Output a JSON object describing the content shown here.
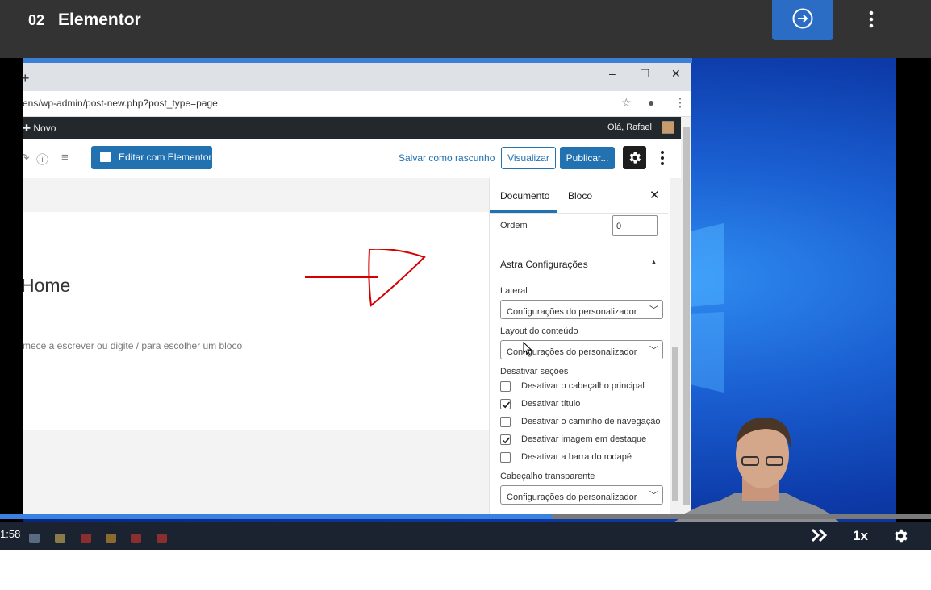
{
  "lesson": {
    "number": "02",
    "title": "Elementor"
  },
  "browser": {
    "new_tab": "+",
    "minimize": "–",
    "maximize": "☐",
    "close": "✕",
    "url": "ens/wp-admin/post-new.php?post_type=page"
  },
  "wp_admin_bar": {
    "new_label": "Novo",
    "greeting": "Olá, Rafael"
  },
  "editor_toolbar": {
    "elementor_button": "Editar com Elementor",
    "save_draft": "Salvar como rascunho",
    "preview": "Visualizar",
    "publish": "Publicar..."
  },
  "canvas": {
    "page_title": "Home",
    "block_placeholder": "mece a escrever ou digite / para escolher um bloco"
  },
  "sidebar": {
    "tabs": [
      "Documento",
      "Bloco"
    ],
    "order_label": "Ordem",
    "order_value": "0",
    "astra_title": "Astra Configurações",
    "lateral_label": "Lateral",
    "lateral_value": "Configurações do personalizador",
    "layout_label": "Layout do conteúdo",
    "layout_value": "Configurações do personalizador",
    "disable_sections_label": "Desativar seções",
    "checkboxes": [
      {
        "label": "Desativar o cabeçalho principal",
        "checked": false
      },
      {
        "label": "Desativar título",
        "checked": true
      },
      {
        "label": "Desativar o caminho de navegação",
        "checked": false
      },
      {
        "label": "Desativar imagem em destaque",
        "checked": true
      },
      {
        "label": "Desativar a barra do rodapé",
        "checked": false
      }
    ],
    "transparent_header_label": "Cabeçalho transparente",
    "transparent_header_value": "Configurações do personalizador"
  },
  "player": {
    "time": "1:58",
    "speed": "1x",
    "progress_fraction": 0.593
  },
  "colors": {
    "accent": "#2271b1",
    "player_blue": "#2b6cc4",
    "topbar": "#333333"
  }
}
